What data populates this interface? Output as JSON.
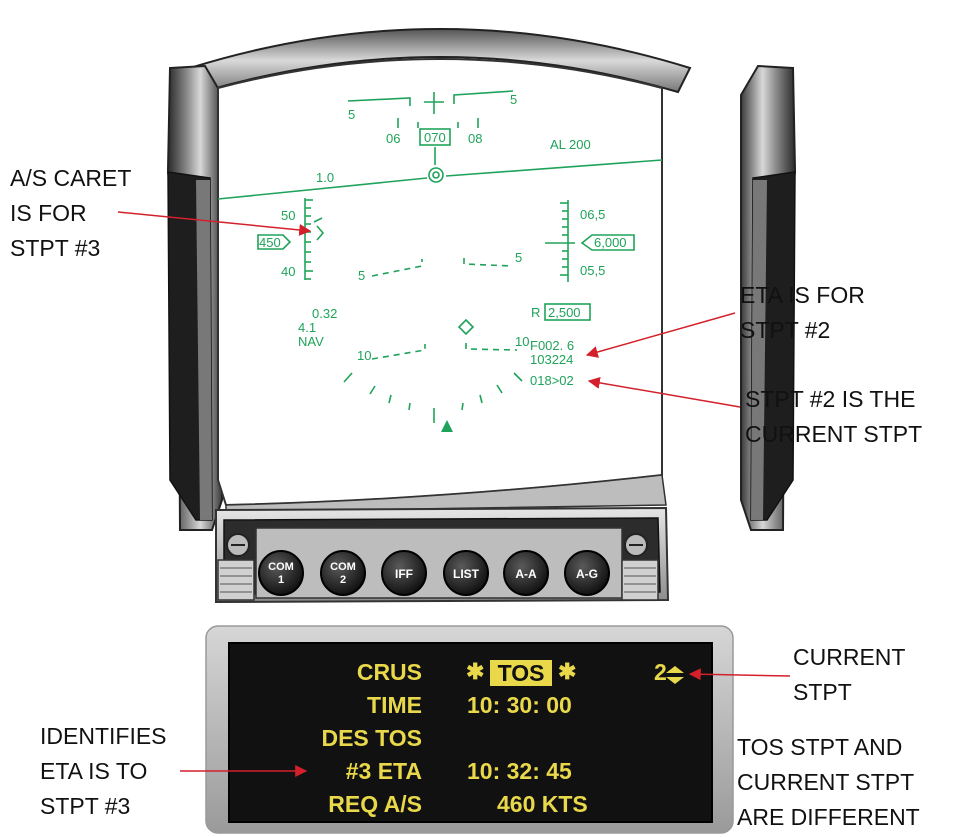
{
  "callouts": {
    "as_caret": [
      "A/S CARET",
      "IS FOR",
      "STPT #3"
    ],
    "eta_is_for": [
      "ETA IS FOR",
      "STPT #2"
    ],
    "current_stpt_2": [
      "STPT #2 IS THE",
      "CURRENT STPT"
    ],
    "current_stpt": [
      "CURRENT",
      "STPT"
    ],
    "identifies": [
      "IDENTIFIES",
      "ETA IS TO",
      "STPT #3"
    ],
    "tos_vs_current": [
      "TOS STPT AND",
      "CURRENT STPT",
      "ARE DIFFERENT"
    ]
  },
  "hud": {
    "pitch_top_left": "5",
    "pitch_top_right": "5",
    "heading_left": "06",
    "heading_center": "070",
    "heading_right": "08",
    "altitude_low": "AL  200",
    "g_load": "1.0",
    "airspeed_upper": "50",
    "airspeed_box": "450",
    "airspeed_lower": "40",
    "alt_upper": "06,5",
    "alt_box": "6,000",
    "alt_lower": "05,5",
    "pitch_mid_left": "5",
    "pitch_mid_right": "5",
    "radar_alt": "R",
    "radar_alt_box": "2,500",
    "mach": "0.32",
    "g_max": "4.1",
    "mode": "NAV",
    "pitch_low_left": "10",
    "pitch_low_right": "10",
    "dist": "F002. 6",
    "eta": "103224",
    "stpt_readout": "018>02"
  },
  "buttons": [
    {
      "line1": "COM",
      "line2": "1"
    },
    {
      "line1": "COM",
      "line2": "2"
    },
    {
      "line1": "IFF",
      "line2": ""
    },
    {
      "line1": "LIST",
      "line2": ""
    },
    {
      "line1": "A-A",
      "line2": ""
    },
    {
      "line1": "A-G",
      "line2": ""
    }
  ],
  "ded": {
    "row1_label": "CRUS",
    "row1_mode": "TOS",
    "row1_stpt": "2",
    "row2_label": "TIME",
    "row2_value": "10: 30: 00",
    "row3_label": "DES TOS",
    "row4_label": "#3 ETA",
    "row4_value": "10: 32: 45",
    "row5_label": "REQ A/S",
    "row5_value": "460 KTS"
  },
  "colors": {
    "hud_green": "#1fa35a",
    "ded_yellow": "#e8d84a",
    "callout_red": "#d4202a"
  }
}
